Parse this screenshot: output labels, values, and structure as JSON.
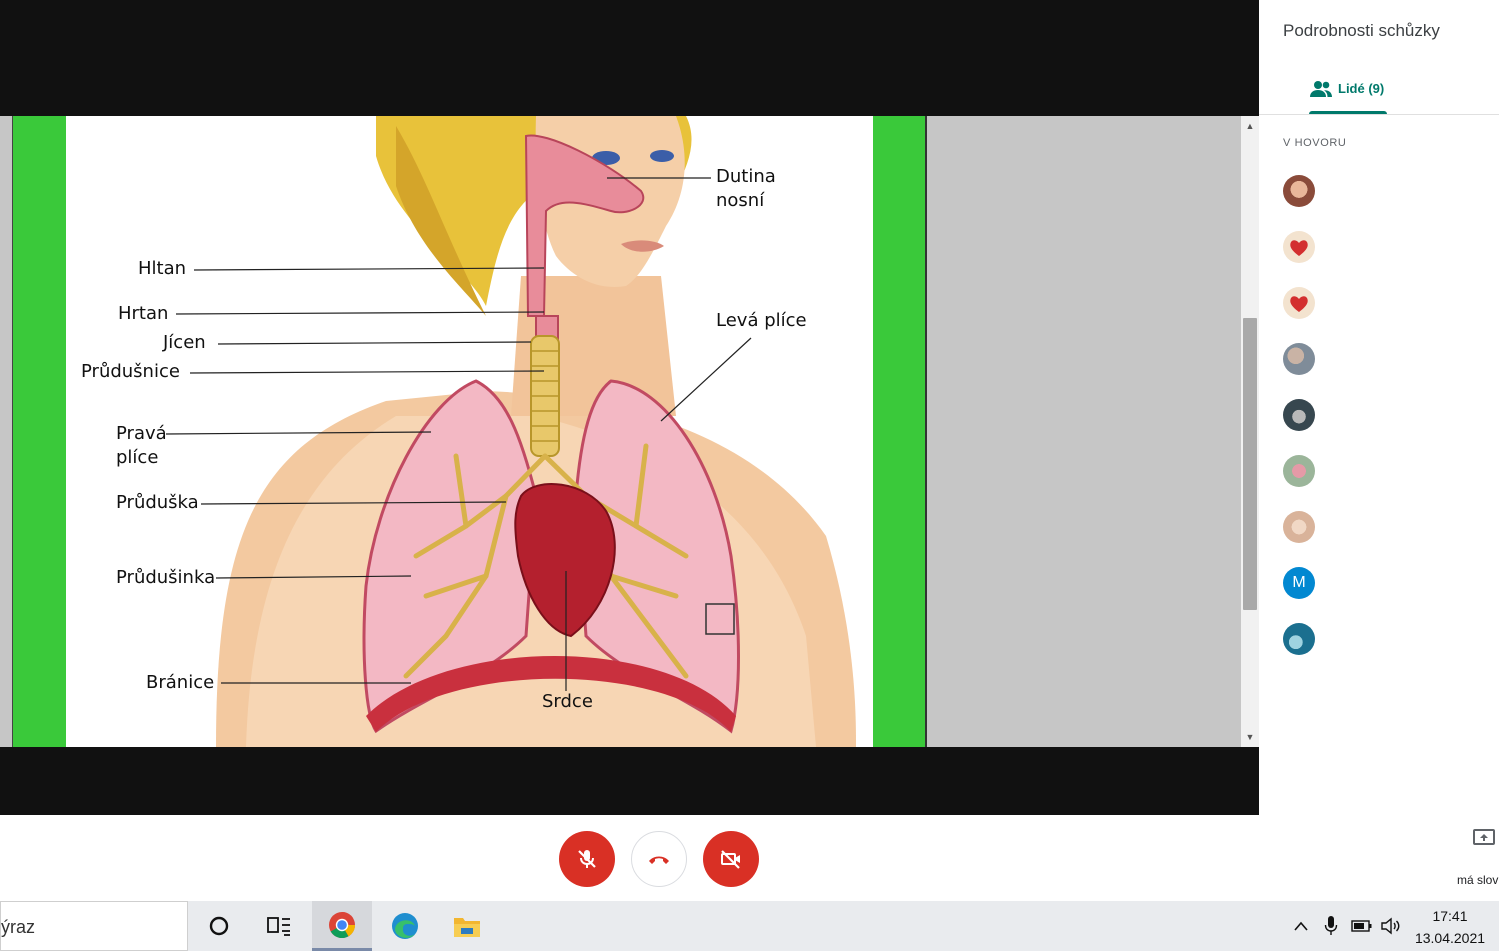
{
  "diagram": {
    "labels": {
      "dutina_line1": "Dutina",
      "dutina_line2": "nosní",
      "hltan": "Hltan",
      "hrtan": "Hrtan",
      "jicen": "Jícen",
      "prudusnice": "Průdušnice",
      "leva_plice": "Levá plíce",
      "prava_line1": "Pravá",
      "prava_line2": "plíce",
      "priduska": "Průduška",
      "prudusinka": "Průdušinka",
      "branice": "Bránice",
      "srdce": "Srdce"
    }
  },
  "panel": {
    "title": "Podrobnosti schůzky",
    "tab_label": "Lidé (9)",
    "section": "V HOVORU",
    "participants": [
      {
        "avatar": "photo-avatar-1",
        "color": "#8a4b3a"
      },
      {
        "avatar": "heart-avatar",
        "color": "#d32f2f"
      },
      {
        "avatar": "heart-avatar",
        "color": "#d32f2f"
      },
      {
        "avatar": "photo-avatar-2",
        "color": "#7f8c99"
      },
      {
        "avatar": "cat-avatar",
        "color": "#37474f"
      },
      {
        "avatar": "photo-avatar-3",
        "color": "#9bb59a"
      },
      {
        "avatar": "photo-avatar-4",
        "color": "#d9b39a"
      },
      {
        "letter": "M",
        "color": "#0288d1"
      },
      {
        "avatar": "wave-avatar",
        "color": "#1b6f8f"
      }
    ]
  },
  "bottombar": {
    "present_text": "má slov"
  },
  "taskbar": {
    "search_text": "ýraz",
    "time": "17:41",
    "date": "13.04.2021"
  },
  "colors": {
    "accent": "#00796b",
    "danger": "#d93025",
    "slide_border": "#3ac93a"
  }
}
